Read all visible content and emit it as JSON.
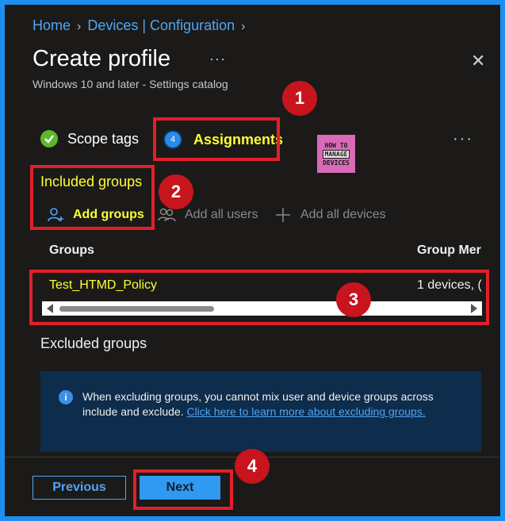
{
  "breadcrumb": {
    "home": "Home",
    "devices": "Devices | Configuration"
  },
  "header": {
    "title": "Create profile",
    "subtitle": "Windows 10 and later - Settings catalog",
    "more": "···",
    "close": "✕"
  },
  "steps": [
    {
      "label": "Scope tags",
      "state": "completed"
    },
    {
      "number": "4",
      "label": "Assignments",
      "state": "active"
    }
  ],
  "steps_more": "···",
  "logo": {
    "line1": "HOW TO",
    "line2": "MANAGE",
    "line3": "DEVICES"
  },
  "included": {
    "title": "Included groups",
    "add_groups": "Add groups",
    "add_all_users": "Add all users",
    "add_all_devices": "Add all devices"
  },
  "table": {
    "columns": [
      "Groups",
      "Group Mer"
    ],
    "rows": [
      {
        "group": "Test_HTMD_Policy",
        "members": "1 devices, ("
      }
    ]
  },
  "excluded": {
    "title": "Excluded groups",
    "info_text": "When excluding groups, you cannot mix user and device groups across include and exclude.",
    "info_link": "Click here to learn more about excluding groups."
  },
  "footer": {
    "previous": "Previous",
    "next": "Next"
  },
  "callouts": [
    "1",
    "2",
    "3",
    "4"
  ],
  "colors": {
    "accent": "#2f9af0",
    "highlight": "#e0202a",
    "badge": "#c8141c",
    "annotation_text": "#ffff33"
  }
}
